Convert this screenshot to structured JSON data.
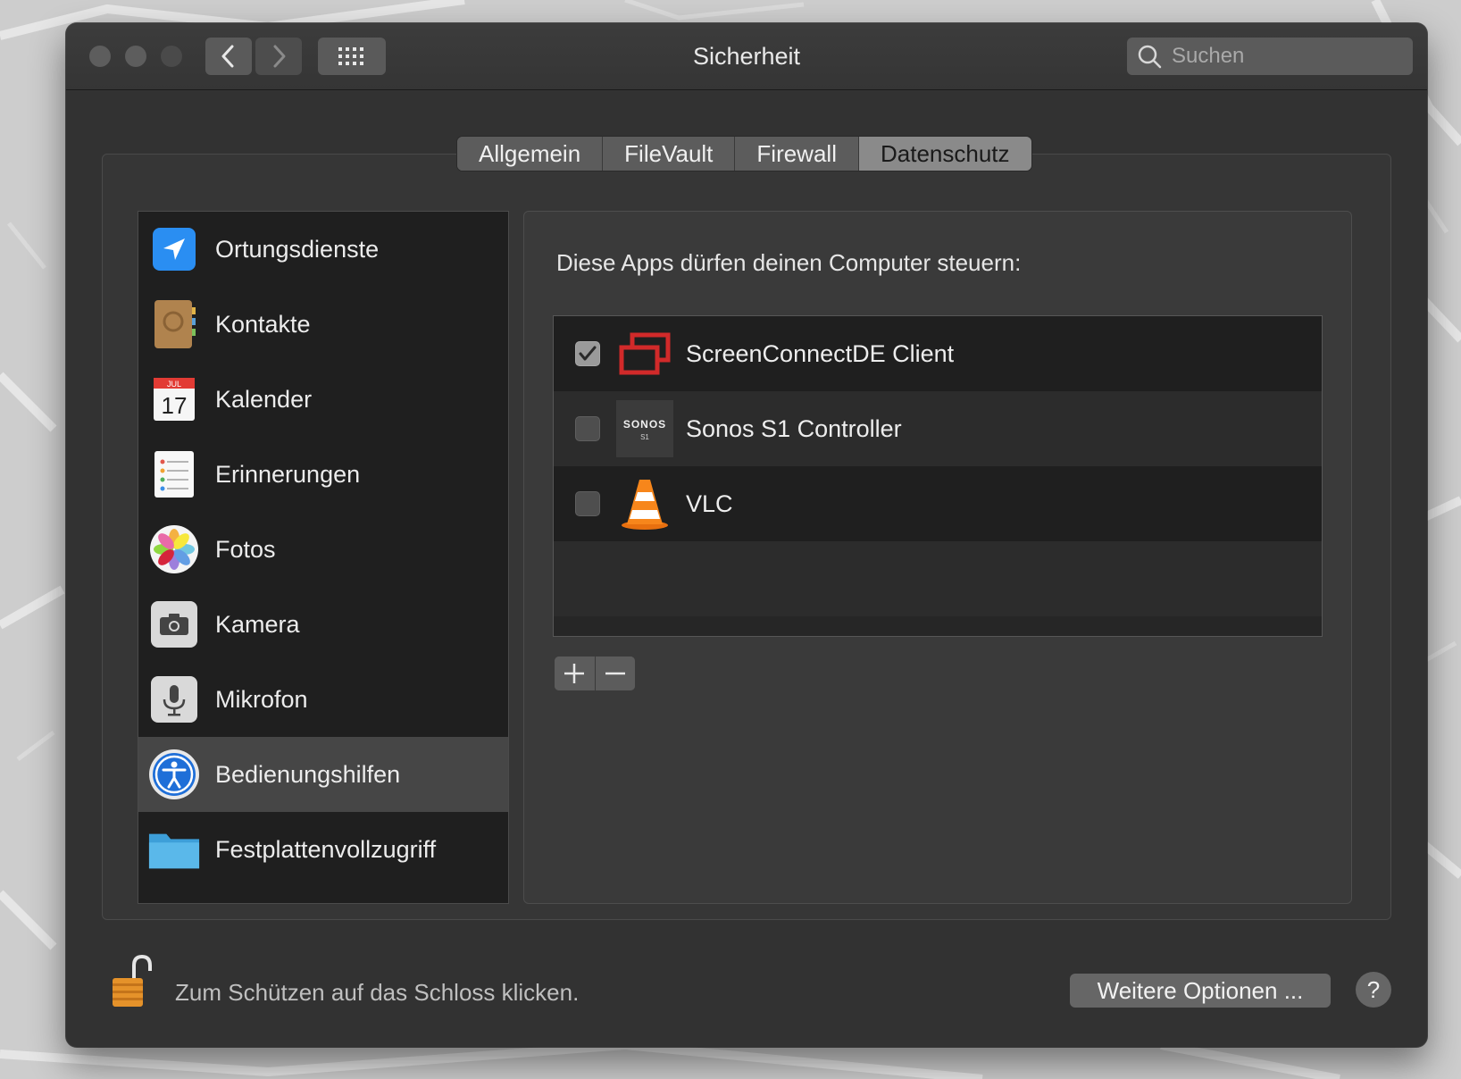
{
  "window": {
    "title": "Sicherheit"
  },
  "toolbar": {
    "back_icon": "chevron-left-icon",
    "forward_icon": "chevron-right-icon",
    "grid_icon": "grid-icon"
  },
  "search": {
    "placeholder": "Suchen",
    "value": ""
  },
  "tabs": [
    {
      "label": "Allgemein",
      "active": false
    },
    {
      "label": "FileVault",
      "active": false
    },
    {
      "label": "Firewall",
      "active": false
    },
    {
      "label": "Datenschutz",
      "active": true
    }
  ],
  "sidebar": {
    "items": [
      {
        "label": "Ortungsdienste",
        "icon": "location-arrow-icon",
        "selected": false
      },
      {
        "label": "Kontakte",
        "icon": "contacts-book-icon",
        "selected": false
      },
      {
        "label": "Kalender",
        "icon": "calendar-icon",
        "selected": false,
        "icon_month": "JUL",
        "icon_day": "17"
      },
      {
        "label": "Erinnerungen",
        "icon": "reminders-icon",
        "selected": false
      },
      {
        "label": "Fotos",
        "icon": "photos-icon",
        "selected": false
      },
      {
        "label": "Kamera",
        "icon": "camera-icon",
        "selected": false
      },
      {
        "label": "Mikrofon",
        "icon": "microphone-icon",
        "selected": false
      },
      {
        "label": "Bedienungshilfen",
        "icon": "accessibility-icon",
        "selected": true
      },
      {
        "label": "Festplattenvollzugriff",
        "icon": "folder-icon",
        "selected": false
      }
    ]
  },
  "main": {
    "heading": "Diese Apps dürfen deinen Computer steuern:",
    "apps": [
      {
        "label": "ScreenConnectDE Client",
        "checked": true,
        "icon": "screenconnect-icon"
      },
      {
        "label": "Sonos S1 Controller",
        "checked": false,
        "icon": "sonos-icon",
        "icon_text": "SONOS",
        "icon_subtext": "S1"
      },
      {
        "label": "VLC",
        "checked": false,
        "icon": "vlc-cone-icon"
      }
    ],
    "add_icon": "plus-icon",
    "remove_icon": "minus-icon"
  },
  "footer": {
    "lock_text": "Zum Schützen auf das Schloss klicken.",
    "lock_icon": "padlock-open-icon",
    "more_options_label": "Weitere Optionen ...",
    "help_label": "?"
  },
  "colors": {
    "window_bg": "#323232",
    "list_bg": "#1f1f1f",
    "selected_row": "#464646",
    "tab_active": "#8a8a8a"
  }
}
